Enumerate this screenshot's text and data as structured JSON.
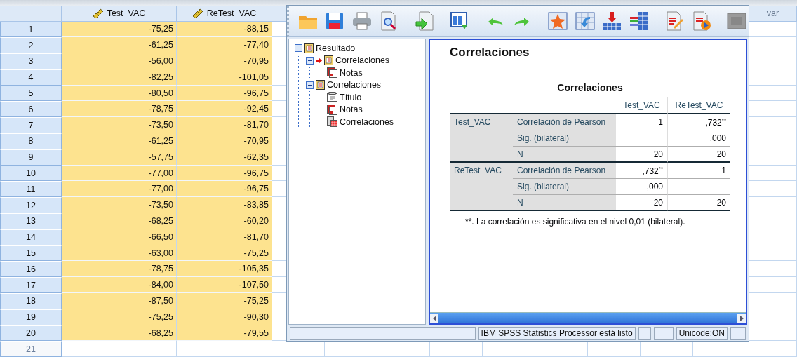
{
  "grid": {
    "columns": [
      {
        "label": "Test_VAC",
        "kind": "scale"
      },
      {
        "label": "ReTest_VAC",
        "kind": "scale"
      }
    ],
    "empty_column_label": "var",
    "rows": [
      {
        "number": "1",
        "values": [
          "-75,25",
          "-88,15"
        ]
      },
      {
        "number": "2",
        "values": [
          "-61,25",
          "-77,40"
        ]
      },
      {
        "number": "3",
        "values": [
          "-56,00",
          "-70,95"
        ]
      },
      {
        "number": "4",
        "values": [
          "-82,25",
          "-101,05"
        ]
      },
      {
        "number": "5",
        "values": [
          "-80,50",
          "-96,75"
        ]
      },
      {
        "number": "6",
        "values": [
          "-78,75",
          "-92,45"
        ]
      },
      {
        "number": "7",
        "values": [
          "-73,50",
          "-81,70"
        ]
      },
      {
        "number": "8",
        "values": [
          "-61,25",
          "-70,95"
        ]
      },
      {
        "number": "9",
        "values": [
          "-57,75",
          "-62,35"
        ]
      },
      {
        "number": "10",
        "values": [
          "-77,00",
          "-96,75"
        ]
      },
      {
        "number": "11",
        "values": [
          "-77,00",
          "-96,75"
        ]
      },
      {
        "number": "12",
        "values": [
          "-73,50",
          "-83,85"
        ]
      },
      {
        "number": "13",
        "values": [
          "-68,25",
          "-60,20"
        ]
      },
      {
        "number": "14",
        "values": [
          "-66,50",
          "-81,70"
        ]
      },
      {
        "number": "15",
        "values": [
          "-63,00",
          "-75,25"
        ]
      },
      {
        "number": "16",
        "values": [
          "-78,75",
          "-105,35"
        ]
      },
      {
        "number": "17",
        "values": [
          "-84,00",
          "-107,50"
        ]
      },
      {
        "number": "18",
        "values": [
          "-87,50",
          "-75,25"
        ]
      },
      {
        "number": "19",
        "values": [
          "-75,25",
          "-90,30"
        ]
      },
      {
        "number": "20",
        "values": [
          "-68,25",
          "-79,55"
        ]
      }
    ],
    "new_row_number": "21"
  },
  "viewer": {
    "outline": [
      {
        "label": "Resultado",
        "kind": "log",
        "expanded": true,
        "current": false,
        "children": [
          {
            "label": "Correlaciones",
            "kind": "log",
            "expanded": true,
            "current": true,
            "children": [
              {
                "label": "Notas",
                "kind": "notes",
                "current": false
              }
            ]
          },
          {
            "label": "Correlaciones",
            "kind": "log",
            "expanded": true,
            "current": false,
            "children": [
              {
                "label": "Título",
                "kind": "title",
                "current": false
              },
              {
                "label": "Notas",
                "kind": "notes",
                "current": false
              },
              {
                "label": "Correlaciones",
                "kind": "table",
                "current": false
              }
            ]
          }
        ]
      }
    ],
    "heading": "Correlaciones",
    "table": {
      "title": "Correlaciones",
      "columns": [
        "Test_VAC",
        "ReTest_VAC"
      ],
      "groups": [
        {
          "variable": "Test_VAC",
          "rows": [
            {
              "statistic": "Correlación de Pearson",
              "test_vac": "1",
              "retest_vac": ",732$^{**}$"
            },
            {
              "statistic": "Sig. (bilateral)",
              "retest_vac": ",000"
            },
            {
              "statistic": "N",
              "test_vac": "20",
              "retest_vac": "20"
            }
          ]
        },
        {
          "variable": "ReTest_VAC",
          "rows": [
            {
              "statistic": "Correlación de Pearson",
              "test_vac": ",732$^{**}$",
              "retest_vac": "1"
            },
            {
              "statistic": "Sig. (bilateral)",
              "test_vac": ",000"
            },
            {
              "statistic": "N",
              "test_vac": "20",
              "retest_vac": "20"
            }
          ]
        }
      ],
      "footnote": "**. La correlación es significativa en el nivel 0,01 (bilateral)."
    },
    "status_bar": {
      "message": "IBM SPSS Statistics Processor está listo",
      "encoding": "Unicode:ON"
    }
  }
}
